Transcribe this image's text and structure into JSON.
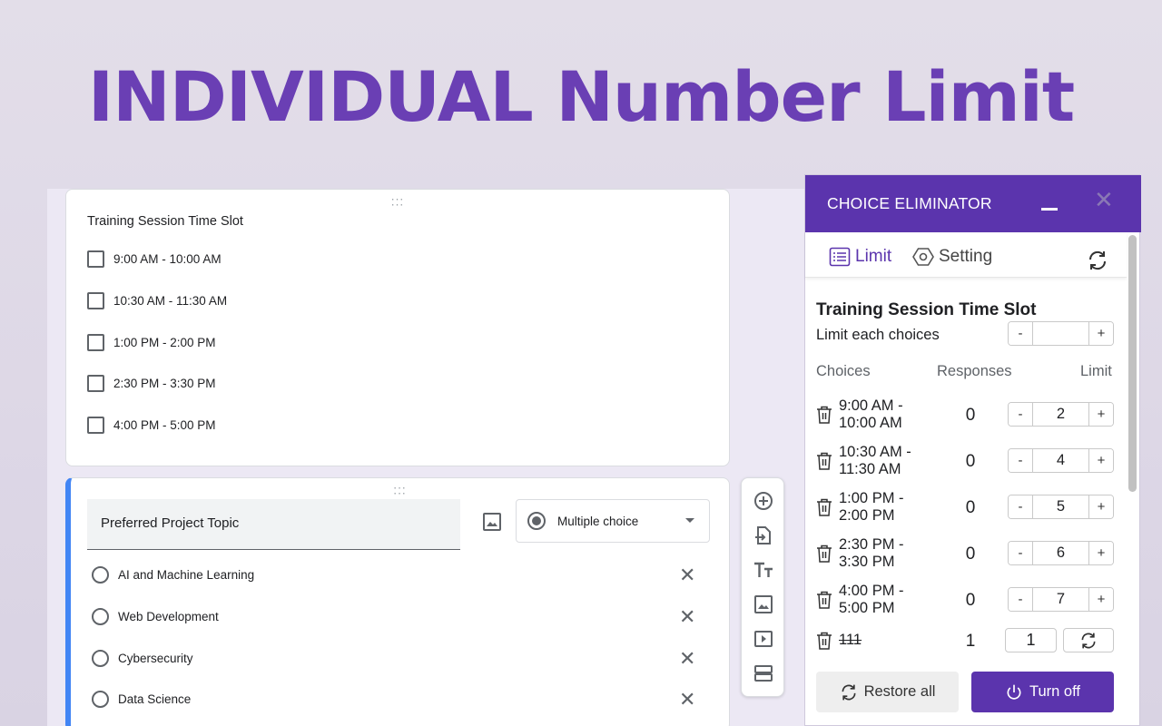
{
  "headline": "INDIVIDUAL Number Limit",
  "form": {
    "question1": {
      "title": "Training Session Time Slot",
      "options": [
        "9:00 AM - 10:00 AM",
        "10:30 AM - 11:30 AM",
        "1:00 PM - 2:00 PM",
        "2:30 PM - 3:30 PM",
        "4:00 PM - 5:00 PM"
      ]
    },
    "question2": {
      "title": "Preferred Project Topic",
      "type": "Multiple choice",
      "options": [
        "AI and Machine Learning",
        "Web Development",
        "Cybersecurity",
        "Data Science"
      ]
    },
    "toolbar_icons": [
      "add-question-icon",
      "import-questions-icon",
      "add-title-icon",
      "add-image-icon",
      "add-video-icon",
      "add-section-icon"
    ]
  },
  "panel": {
    "title": "CHOICE ELIMINATOR",
    "tabs": {
      "limit": "Limit",
      "setting": "Setting"
    },
    "question_title": "Training Session Time Slot",
    "limit_each_label": "Limit each choices",
    "limit_each_value": "",
    "minus": "-",
    "plus": "+",
    "columns": {
      "choices": "Choices",
      "responses": "Responses",
      "limit": "Limit"
    },
    "rows": [
      {
        "line1": "9:00 AM -",
        "line2": "10:00 AM",
        "responses": "0",
        "limit": "2"
      },
      {
        "line1": "10:30 AM -",
        "line2": "11:30 AM",
        "responses": "0",
        "limit": "4"
      },
      {
        "line1": "1:00 PM -",
        "line2": "2:00 PM",
        "responses": "0",
        "limit": "5"
      },
      {
        "line1": "2:30 PM -",
        "line2": "3:30 PM",
        "responses": "0",
        "limit": "6"
      },
      {
        "line1": "4:00 PM -",
        "line2": "5:00 PM",
        "responses": "0",
        "limit": "7"
      }
    ],
    "deleted_row": {
      "choice": "111",
      "responses": "1",
      "limit": "1"
    },
    "restore_all": "Restore all",
    "turn_off": "Turn off"
  },
  "colors": {
    "accent": "#5b34ad",
    "headline": "#6a3fb4",
    "focus_bar": "#4285f4"
  }
}
